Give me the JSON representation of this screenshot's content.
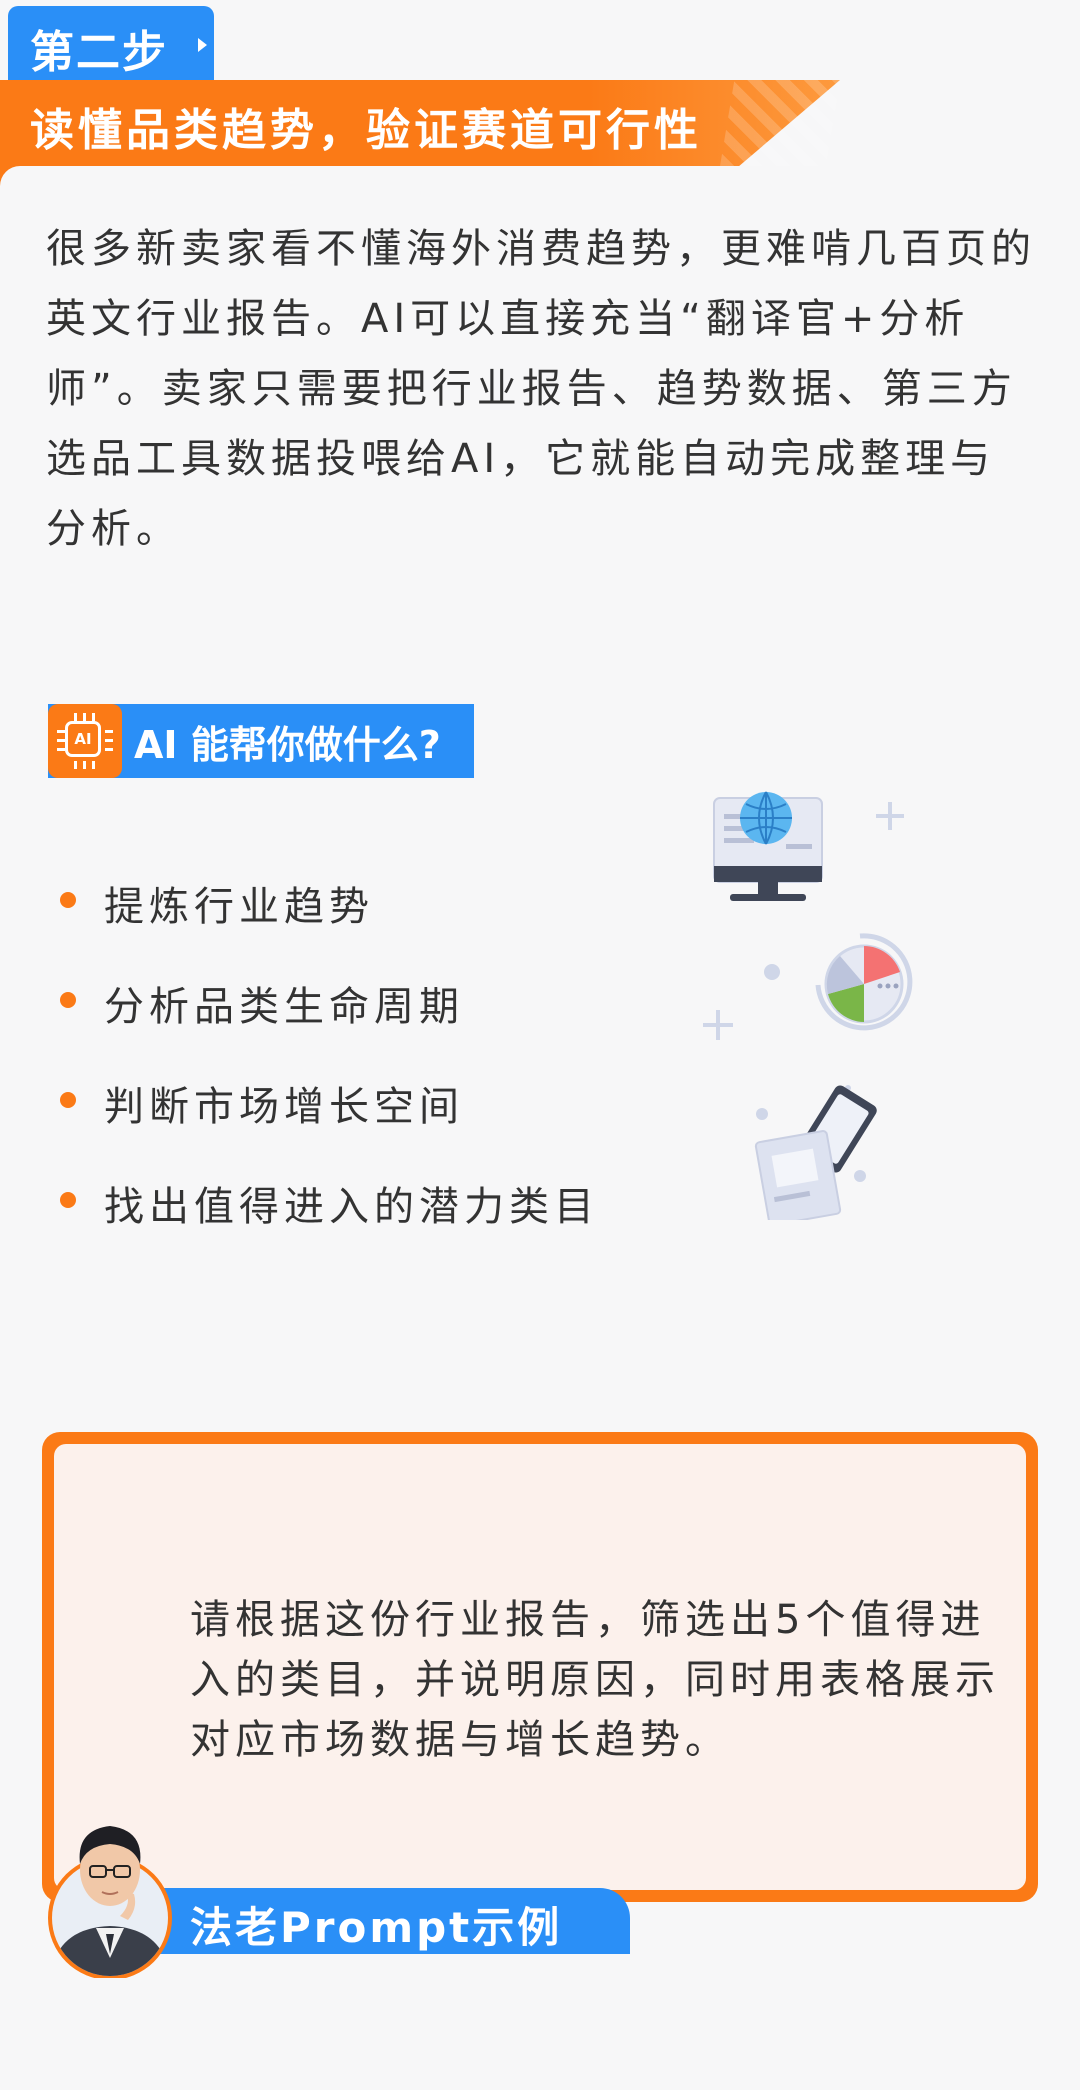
{
  "step": {
    "label": "第二步"
  },
  "banner": {
    "title": "读懂品类趋势，验证赛道可行性"
  },
  "intro": {
    "paragraph": "很多新卖家看不懂海外消费趋势，更难啃几百页的英文行业报告。AI可以直接充当“翻译官+分析师”。卖家只需要把行业报告、趋势数据、第三方选品工具数据投喂给AI，它就能自动完成整理与分析。"
  },
  "ai_section": {
    "chip_text": "AI",
    "title": "AI 能帮你做什么?",
    "bullets": [
      "提炼行业趋势",
      "分析品类生命周期",
      "判断市场增长空间",
      "找出值得进入的潜力类目"
    ],
    "icons": [
      "globe-monitor-icon",
      "pie-chart-cycle-icon",
      "tablet-document-icon"
    ]
  },
  "prompt": {
    "text": "请根据这份行业报告，筛选出5个值得进入的类目，并说明原因，同时用表格展示对应市场数据与增长趋势。",
    "label": "法老Prompt示例"
  },
  "colors": {
    "orange": "#fb7a16",
    "blue": "#2a8ff7",
    "card_bg": "#fcf1ec",
    "page_bg": "#f7f7f8"
  }
}
